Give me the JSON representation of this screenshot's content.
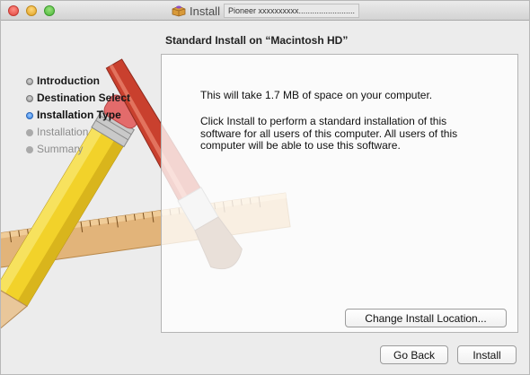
{
  "window": {
    "title": "Install",
    "package_name": "Pioneer xxxxxxxxxx........................."
  },
  "heading": "Standard Install on “Macintosh HD”",
  "sidebar": {
    "steps": [
      {
        "label": "Introduction",
        "state": "done"
      },
      {
        "label": "Destination Select",
        "state": "done"
      },
      {
        "label": "Installation Type",
        "state": "current"
      },
      {
        "label": "Installation",
        "state": "todo"
      },
      {
        "label": "Summary",
        "state": "todo"
      }
    ]
  },
  "content": {
    "space_text": "This will take 1.7 MB of space on your computer.",
    "description": "Click Install to perform a standard installation of this software for all users of this computer. All users of this computer will be able to use this software.",
    "change_location_label": "Change Install Location..."
  },
  "buttons": {
    "back_label": "Go Back",
    "install_label": "Install"
  },
  "colors": {
    "accent": "#2f7ce0",
    "ruler": "#d9a86a",
    "pencil_body": "#f2d22a",
    "brush_handle": "#c9402e"
  }
}
